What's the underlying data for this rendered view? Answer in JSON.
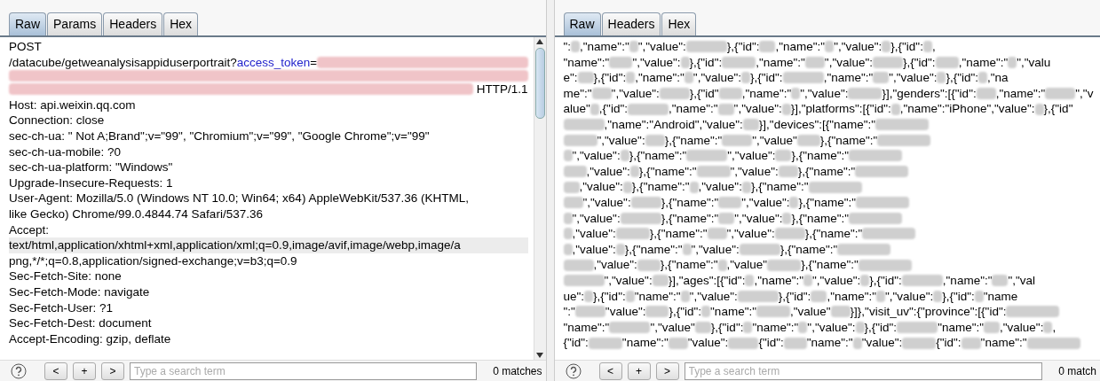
{
  "panels": [
    {
      "tabs": [
        {
          "label": "Raw",
          "selected": true
        },
        {
          "label": "Params",
          "selected": false
        },
        {
          "label": "Headers",
          "selected": false
        },
        {
          "label": "Hex",
          "selected": false
        }
      ],
      "lines": [
        {
          "current": false,
          "segments": [
            {
              "kind": "text",
              "text": "POST"
            }
          ]
        },
        {
          "current": false,
          "segments": [
            {
              "kind": "text",
              "text": "/datacube/getweanalysisappiduserportrait?"
            },
            {
              "kind": "param",
              "text": "access_token"
            },
            {
              "kind": "text",
              "text": "="
            },
            {
              "kind": "blur"
            }
          ]
        },
        {
          "current": false,
          "segments": [
            {
              "kind": "blur"
            }
          ]
        },
        {
          "current": false,
          "segments": [
            {
              "kind": "blur"
            },
            {
              "kind": "text",
              "text": " HTTP/1.1"
            }
          ]
        },
        {
          "current": false,
          "segments": [
            {
              "kind": "text",
              "text": "Host: api.weixin.qq.com"
            }
          ]
        },
        {
          "current": false,
          "segments": [
            {
              "kind": "text",
              "text": "Connection: close"
            }
          ]
        },
        {
          "current": false,
          "segments": [
            {
              "kind": "text",
              "text": "sec-ch-ua: \" Not A;Brand\";v=\"99\", \"Chromium\";v=\"99\", \"Google Chrome\";v=\"99\""
            }
          ]
        },
        {
          "current": false,
          "segments": [
            {
              "kind": "text",
              "text": "sec-ch-ua-mobile: ?0"
            }
          ]
        },
        {
          "current": false,
          "segments": [
            {
              "kind": "text",
              "text": "sec-ch-ua-platform: \"Windows\""
            }
          ]
        },
        {
          "current": false,
          "segments": [
            {
              "kind": "text",
              "text": "Upgrade-Insecure-Requests: 1"
            }
          ]
        },
        {
          "current": false,
          "segments": [
            {
              "kind": "text",
              "text": "User-Agent: Mozilla/5.0 (Windows NT 10.0; Win64; x64) AppleWebKit/537.36 (KHTML,"
            }
          ]
        },
        {
          "current": false,
          "segments": [
            {
              "kind": "text",
              "text": "like Gecko) Chrome/99.0.4844.74 Safari/537.36"
            }
          ]
        },
        {
          "current": false,
          "segments": [
            {
              "kind": "text",
              "text": "Accept:"
            }
          ]
        },
        {
          "current": true,
          "segments": [
            {
              "kind": "text",
              "text": "text/html,application/xhtml+xml,application/xml;q=0.9,image/avif,image/webp,image/a"
            }
          ]
        },
        {
          "current": false,
          "segments": [
            {
              "kind": "text",
              "text": "png,*/*;q=0.8,application/signed-exchange;v=b3;q=0.9"
            }
          ]
        },
        {
          "current": false,
          "segments": [
            {
              "kind": "text",
              "text": "Sec-Fetch-Site: none"
            }
          ]
        },
        {
          "current": false,
          "segments": [
            {
              "kind": "text",
              "text": "Sec-Fetch-Mode: navigate"
            }
          ]
        },
        {
          "current": false,
          "segments": [
            {
              "kind": "text",
              "text": "Sec-Fetch-User: ?1"
            }
          ]
        },
        {
          "current": false,
          "segments": [
            {
              "kind": "text",
              "text": "Sec-Fetch-Dest: document"
            }
          ]
        },
        {
          "current": false,
          "segments": [
            {
              "kind": "text",
              "text": "Accept-Encoding: gzip, deflate"
            }
          ]
        }
      ],
      "search": {
        "buttons": [
          "<",
          "+",
          ">"
        ],
        "placeholder": "Type a search term",
        "matches": "0 matches"
      }
    },
    {
      "tabs": [
        {
          "label": "Raw",
          "selected": true
        },
        {
          "label": "Headers",
          "selected": false
        },
        {
          "label": "Hex",
          "selected": false
        }
      ],
      "lines": [
        {
          "current": false,
          "segments": [
            {
              "kind": "text",
              "text": "\":"
            },
            {
              "kind": "blur"
            },
            {
              "kind": "text",
              "text": ",\"name\":\""
            },
            {
              "kind": "blur"
            },
            {
              "kind": "text",
              "text": "\",\"value\":"
            },
            {
              "kind": "blur"
            },
            {
              "kind": "text",
              "text": "},{\"id\":"
            },
            {
              "kind": "blur"
            },
            {
              "kind": "text",
              "text": ",\"name\":\""
            },
            {
              "kind": "blur"
            },
            {
              "kind": "text",
              "text": "\",\"value\":"
            },
            {
              "kind": "blur"
            },
            {
              "kind": "text",
              "text": "},{\"id\":"
            },
            {
              "kind": "blur"
            },
            {
              "kind": "text",
              "text": ","
            }
          ]
        },
        {
          "current": false,
          "segments": [
            {
              "kind": "text",
              "text": "\"name\":\""
            },
            {
              "kind": "blur"
            },
            {
              "kind": "text",
              "text": "\",\"value\":"
            },
            {
              "kind": "blur"
            },
            {
              "kind": "text",
              "text": "},{\"id\":"
            },
            {
              "kind": "blur"
            },
            {
              "kind": "text",
              "text": ",\"name\":\""
            },
            {
              "kind": "blur"
            },
            {
              "kind": "text",
              "text": "\",\"value\":"
            },
            {
              "kind": "blur"
            },
            {
              "kind": "text",
              "text": "},{\"id\":"
            },
            {
              "kind": "blur"
            },
            {
              "kind": "text",
              "text": ",\"name\":\""
            },
            {
              "kind": "blur"
            },
            {
              "kind": "text",
              "text": "\",\"valu"
            }
          ]
        },
        {
          "current": false,
          "segments": [
            {
              "kind": "text",
              "text": "e\":"
            },
            {
              "kind": "blur"
            },
            {
              "kind": "text",
              "text": "},{\"id\":"
            },
            {
              "kind": "blur"
            },
            {
              "kind": "text",
              "text": ",\"name\":\""
            },
            {
              "kind": "blur"
            },
            {
              "kind": "text",
              "text": "\",\"value\":"
            },
            {
              "kind": "blur"
            },
            {
              "kind": "text",
              "text": "},{\"id\":"
            },
            {
              "kind": "blur"
            },
            {
              "kind": "text",
              "text": ",\"name\":\""
            },
            {
              "kind": "blur"
            },
            {
              "kind": "text",
              "text": "\",\"value\":"
            },
            {
              "kind": "blur"
            },
            {
              "kind": "text",
              "text": "},{\"id\":"
            },
            {
              "kind": "blur"
            },
            {
              "kind": "text",
              "text": ",\"na"
            }
          ]
        },
        {
          "current": false,
          "segments": [
            {
              "kind": "text",
              "text": "me\":\""
            },
            {
              "kind": "blur"
            },
            {
              "kind": "text",
              "text": "\",\"value\":"
            },
            {
              "kind": "blur"
            },
            {
              "kind": "text",
              "text": "},{\"id\""
            },
            {
              "kind": "blur"
            },
            {
              "kind": "text",
              "text": ",\"name\":\""
            },
            {
              "kind": "blur"
            },
            {
              "kind": "text",
              "text": "\",\"value\":"
            },
            {
              "kind": "blur"
            },
            {
              "kind": "text",
              "text": "}],\"genders\":[{\"id\":"
            },
            {
              "kind": "blur"
            },
            {
              "kind": "text",
              "text": ",\"name\":\""
            },
            {
              "kind": "blur"
            },
            {
              "kind": "text",
              "text": "\",\"v"
            }
          ]
        },
        {
          "current": false,
          "segments": [
            {
              "kind": "text",
              "text": "alue\""
            },
            {
              "kind": "blur"
            },
            {
              "kind": "text",
              "text": ",{\"id\":"
            },
            {
              "kind": "blur"
            },
            {
              "kind": "text",
              "text": ",\"name\":\""
            },
            {
              "kind": "blur"
            },
            {
              "kind": "text",
              "text": "\",\"value\":"
            },
            {
              "kind": "blur"
            },
            {
              "kind": "text",
              "text": "}],\"platforms\":[{\"id\":"
            },
            {
              "kind": "blur"
            },
            {
              "kind": "text",
              "text": ",\"name\":\"iPhone\",\"value\":"
            },
            {
              "kind": "blur"
            },
            {
              "kind": "text",
              "text": "},{\"id\""
            }
          ]
        },
        {
          "current": false,
          "segments": [
            {
              "kind": "blur"
            },
            {
              "kind": "text",
              "text": ",\"name\":\"Android\",\"value\":"
            },
            {
              "kind": "blur"
            },
            {
              "kind": "text",
              "text": "}],\"devices\":[{\"name\":\""
            },
            {
              "kind": "blur"
            }
          ]
        },
        {
          "current": false,
          "segments": [
            {
              "kind": "blur"
            },
            {
              "kind": "text",
              "text": "\",\"value\":"
            },
            {
              "kind": "blur"
            },
            {
              "kind": "text",
              "text": "},{\"name\":\""
            },
            {
              "kind": "blur"
            },
            {
              "kind": "text",
              "text": "\",\"value\""
            },
            {
              "kind": "blur"
            },
            {
              "kind": "text",
              "text": "},{\"name\":\""
            },
            {
              "kind": "blur"
            }
          ]
        },
        {
          "current": false,
          "segments": [
            {
              "kind": "blur"
            },
            {
              "kind": "text",
              "text": "\",\"value\":"
            },
            {
              "kind": "blur"
            },
            {
              "kind": "text",
              "text": "},{\"name\":\""
            },
            {
              "kind": "blur"
            },
            {
              "kind": "text",
              "text": "\",\"value\":"
            },
            {
              "kind": "blur"
            },
            {
              "kind": "text",
              "text": "},{\"name\":\""
            },
            {
              "kind": "blur"
            }
          ]
        },
        {
          "current": false,
          "segments": [
            {
              "kind": "blur"
            },
            {
              "kind": "text",
              "text": ",\"value\":"
            },
            {
              "kind": "blur"
            },
            {
              "kind": "text",
              "text": "},{\"name\":\""
            },
            {
              "kind": "blur"
            },
            {
              "kind": "text",
              "text": "\",\"value\":"
            },
            {
              "kind": "blur"
            },
            {
              "kind": "text",
              "text": "},{\"name\":\""
            },
            {
              "kind": "blur"
            }
          ]
        },
        {
          "current": false,
          "segments": [
            {
              "kind": "blur"
            },
            {
              "kind": "text",
              "text": ",\"value\":"
            },
            {
              "kind": "blur"
            },
            {
              "kind": "text",
              "text": "},{\"name\":\""
            },
            {
              "kind": "blur"
            },
            {
              "kind": "text",
              "text": ",\"value\":"
            },
            {
              "kind": "blur"
            },
            {
              "kind": "text",
              "text": "},{\"name\":\""
            },
            {
              "kind": "blur"
            }
          ]
        },
        {
          "current": false,
          "segments": [
            {
              "kind": "blur"
            },
            {
              "kind": "text",
              "text": "\",\"value\":"
            },
            {
              "kind": "blur"
            },
            {
              "kind": "text",
              "text": "},{\"name\":\""
            },
            {
              "kind": "blur"
            },
            {
              "kind": "text",
              "text": "\",\"value\":"
            },
            {
              "kind": "blur"
            },
            {
              "kind": "text",
              "text": "},{\"name\":\""
            },
            {
              "kind": "blur"
            }
          ]
        },
        {
          "current": false,
          "segments": [
            {
              "kind": "blur"
            },
            {
              "kind": "text",
              "text": "\",\"value\":"
            },
            {
              "kind": "blur"
            },
            {
              "kind": "text",
              "text": "},{\"name\":\""
            },
            {
              "kind": "blur"
            },
            {
              "kind": "text",
              "text": "\",\"value\":"
            },
            {
              "kind": "blur"
            },
            {
              "kind": "text",
              "text": "},{\"name\":\""
            },
            {
              "kind": "blur"
            }
          ]
        },
        {
          "current": false,
          "segments": [
            {
              "kind": "blur"
            },
            {
              "kind": "text",
              "text": ",\"value\":"
            },
            {
              "kind": "blur"
            },
            {
              "kind": "text",
              "text": "},{\"name\":\""
            },
            {
              "kind": "blur"
            },
            {
              "kind": "text",
              "text": "\",\"value\":"
            },
            {
              "kind": "blur"
            },
            {
              "kind": "text",
              "text": "},{\"name\":\""
            },
            {
              "kind": "blur"
            }
          ]
        },
        {
          "current": false,
          "segments": [
            {
              "kind": "blur"
            },
            {
              "kind": "text",
              "text": ",\"value\":"
            },
            {
              "kind": "blur"
            },
            {
              "kind": "text",
              "text": "},{\"name\":\""
            },
            {
              "kind": "blur"
            },
            {
              "kind": "text",
              "text": "\",\"value\":"
            },
            {
              "kind": "blur"
            },
            {
              "kind": "text",
              "text": "},{\"name\":\""
            },
            {
              "kind": "blur"
            }
          ]
        },
        {
          "current": false,
          "segments": [
            {
              "kind": "blur"
            },
            {
              "kind": "text",
              "text": ",\"value\":"
            },
            {
              "kind": "blur"
            },
            {
              "kind": "text",
              "text": "},{\"name\":\""
            },
            {
              "kind": "blur"
            },
            {
              "kind": "text",
              "text": ",\"value\""
            },
            {
              "kind": "blur"
            },
            {
              "kind": "text",
              "text": "},{\"name\":\""
            },
            {
              "kind": "blur"
            }
          ]
        },
        {
          "current": false,
          "segments": [
            {
              "kind": "blur"
            },
            {
              "kind": "text",
              "text": "\",\"value\":"
            },
            {
              "kind": "blur"
            },
            {
              "kind": "text",
              "text": "}],\"ages\":[{\"id\":"
            },
            {
              "kind": "blur"
            },
            {
              "kind": "text",
              "text": ",\"name\":\""
            },
            {
              "kind": "blur"
            },
            {
              "kind": "text",
              "text": "\",\"value\":"
            },
            {
              "kind": "blur"
            },
            {
              "kind": "text",
              "text": "},{\"id\":"
            },
            {
              "kind": "blur"
            },
            {
              "kind": "text",
              "text": ",\"name\":\""
            },
            {
              "kind": "blur"
            },
            {
              "kind": "text",
              "text": "\",\"val"
            }
          ]
        },
        {
          "current": false,
          "segments": [
            {
              "kind": "text",
              "text": "ue\":"
            },
            {
              "kind": "blur"
            },
            {
              "kind": "text",
              "text": "},{\"id\":"
            },
            {
              "kind": "blur"
            },
            {
              "kind": "text",
              "text": "\"name\":\""
            },
            {
              "kind": "blur"
            },
            {
              "kind": "text",
              "text": "\",\"value\":"
            },
            {
              "kind": "blur"
            },
            {
              "kind": "text",
              "text": "},{\"id\":"
            },
            {
              "kind": "blur"
            },
            {
              "kind": "text",
              "text": ",\"name\":\""
            },
            {
              "kind": "blur"
            },
            {
              "kind": "text",
              "text": "\",\"value\":"
            },
            {
              "kind": "blur"
            },
            {
              "kind": "text",
              "text": "},{\"id\":"
            },
            {
              "kind": "blur"
            },
            {
              "kind": "text",
              "text": "\"name"
            }
          ]
        },
        {
          "current": false,
          "segments": [
            {
              "kind": "text",
              "text": "\":\""
            },
            {
              "kind": "blur"
            },
            {
              "kind": "text",
              "text": "\"value\":"
            },
            {
              "kind": "blur"
            },
            {
              "kind": "text",
              "text": "},{\"id\":"
            },
            {
              "kind": "blur"
            },
            {
              "kind": "text",
              "text": "\"name\":\""
            },
            {
              "kind": "blur"
            },
            {
              "kind": "text",
              "text": ",\"value\""
            },
            {
              "kind": "blur"
            },
            {
              "kind": "text",
              "text": "}]},\"visit_uv\":{\"province\":[{\"id\":"
            },
            {
              "kind": "blur"
            }
          ]
        },
        {
          "current": false,
          "segments": [
            {
              "kind": "text",
              "text": "\"name\":\""
            },
            {
              "kind": "blur"
            },
            {
              "kind": "text",
              "text": "\",\"value\""
            },
            {
              "kind": "blur"
            },
            {
              "kind": "text",
              "text": "},{\"id\":"
            },
            {
              "kind": "blur"
            },
            {
              "kind": "text",
              "text": "\"name\":\""
            },
            {
              "kind": "blur"
            },
            {
              "kind": "text",
              "text": "\",\"value\":"
            },
            {
              "kind": "blur"
            },
            {
              "kind": "text",
              "text": "},{\"id\":"
            },
            {
              "kind": "blur"
            },
            {
              "kind": "text",
              "text": "\"name\":\""
            },
            {
              "kind": "blur"
            },
            {
              "kind": "text",
              "text": ",\"value\":"
            },
            {
              "kind": "blur"
            },
            {
              "kind": "text",
              "text": ","
            }
          ]
        },
        {
          "current": false,
          "segments": [
            {
              "kind": "text",
              "text": "{\"id\":"
            },
            {
              "kind": "blur"
            },
            {
              "kind": "text",
              "text": "\"name\":\""
            },
            {
              "kind": "blur"
            },
            {
              "kind": "text",
              "text": "\"value\":"
            },
            {
              "kind": "blur"
            },
            {
              "kind": "text",
              "text": "{\"id\":"
            },
            {
              "kind": "blur"
            },
            {
              "kind": "text",
              "text": "\"name\":\""
            },
            {
              "kind": "blur"
            },
            {
              "kind": "text",
              "text": "\"value\":"
            },
            {
              "kind": "blur"
            },
            {
              "kind": "text",
              "text": "{\"id\":"
            },
            {
              "kind": "blur"
            },
            {
              "kind": "text",
              "text": "\"name\":\""
            },
            {
              "kind": "blur"
            }
          ]
        }
      ],
      "search": {
        "buttons": [
          "<",
          "+",
          ">"
        ],
        "placeholder": "Type a search term",
        "matches": "0 match"
      }
    }
  ]
}
